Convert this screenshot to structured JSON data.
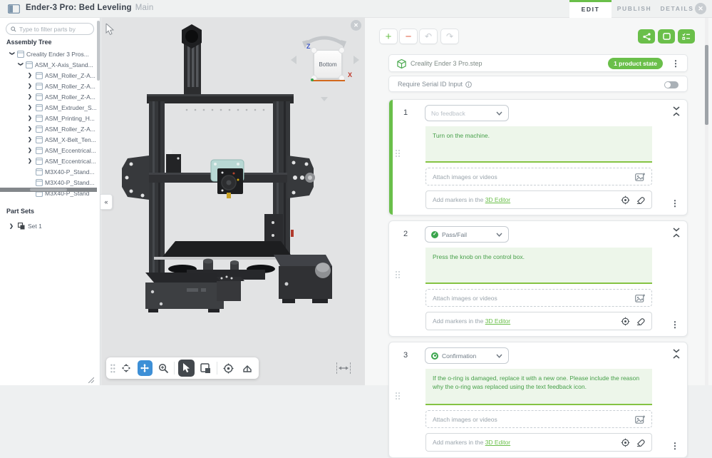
{
  "header": {
    "title": "Ender-3 Pro: Bed Leveling",
    "variant": "Main",
    "tabs": [
      {
        "label": "EDIT",
        "active": true
      },
      {
        "label": "PUBLISH",
        "active": false
      },
      {
        "label": "DETAILS",
        "active": false
      }
    ],
    "icons": [
      "app-layout-icon",
      "window-close-icon"
    ]
  },
  "sidebar": {
    "search_placeholder": "Type to filter parts by",
    "tree_label": "Assembly Tree",
    "tree": [
      {
        "label": "Creality Ender 3 Pros...",
        "depth": 0,
        "expanded": true,
        "expandable": true,
        "type": "assembly"
      },
      {
        "label": "ASM_X-Axis_Stand...",
        "depth": 1,
        "expanded": true,
        "expandable": true,
        "type": "assembly"
      },
      {
        "label": "ASM_Roller_Z-A...",
        "depth": 2,
        "expanded": false,
        "expandable": true,
        "type": "assembly"
      },
      {
        "label": "ASM_Roller_Z-A...",
        "depth": 2,
        "expanded": false,
        "expandable": true,
        "type": "assembly"
      },
      {
        "label": "ASM_Roller_Z-A...",
        "depth": 2,
        "expanded": false,
        "expandable": true,
        "type": "assembly"
      },
      {
        "label": "ASM_Extruder_S...",
        "depth": 2,
        "expanded": false,
        "expandable": true,
        "type": "assembly"
      },
      {
        "label": "ASM_Printing_H...",
        "depth": 2,
        "expanded": false,
        "expandable": true,
        "type": "assembly"
      },
      {
        "label": "ASM_Roller_Z-A...",
        "depth": 2,
        "expanded": false,
        "expandable": true,
        "type": "assembly"
      },
      {
        "label": "ASM_X-Belt_Ten...",
        "depth": 2,
        "expanded": false,
        "expandable": true,
        "type": "assembly"
      },
      {
        "label": "ASM_Eccentrical...",
        "depth": 2,
        "expanded": false,
        "expandable": true,
        "type": "assembly"
      },
      {
        "label": "ASM_Eccentrical...",
        "depth": 2,
        "expanded": false,
        "expandable": true,
        "type": "assembly"
      },
      {
        "label": "M3X40-P_Stand...",
        "depth": 2,
        "expanded": false,
        "expandable": false,
        "type": "part"
      },
      {
        "label": "M3X40-P_Stand...",
        "depth": 2,
        "expanded": false,
        "expandable": false,
        "type": "part"
      },
      {
        "label": "M3X40-P_Stand",
        "depth": 2,
        "expanded": false,
        "expandable": false,
        "type": "part"
      }
    ],
    "part_sets_label": "Part Sets",
    "part_sets": [
      {
        "label": "Set 1"
      }
    ]
  },
  "viewport": {
    "view_cube_label": "Bottom",
    "axis_z": "Z",
    "axis_x": "X",
    "toolbar_icons": [
      "drag-handle-icon",
      "orbit-icon",
      "pan-icon",
      "zoom-icon",
      "select-cursor-icon",
      "box-select-icon",
      "focus-target-icon",
      "section-icon"
    ],
    "active_tools": [
      "pan-icon",
      "select-cursor-icon"
    ],
    "other_icons": [
      "viewport-close-icon",
      "fit-width-icon",
      "mouse-cursor"
    ]
  },
  "editor": {
    "toolbar": {
      "left_icons": [
        "add-step-icon",
        "remove-step-icon",
        "undo-icon",
        "redo-icon"
      ],
      "right_icons": [
        "share-icon",
        "display-icon",
        "checklist-icon",
        "overflow-menu-icon"
      ]
    },
    "product": {
      "name": "Creality Ender 3 Pro.step",
      "badge": "1 product state"
    },
    "serial": {
      "label": "Require Serial ID Input",
      "toggle_on": false
    },
    "attach_label": "Attach images or videos",
    "markers_prefix": "Add markers in the ",
    "markers_link": "3D Editor",
    "steps": [
      {
        "number": "1",
        "feedback": "No feedback",
        "feedback_icon": "none",
        "placeholder": true,
        "selected": true,
        "text": "Turn on the machine."
      },
      {
        "number": "2",
        "feedback": "Pass/Fail",
        "feedback_icon": "check",
        "placeholder": false,
        "selected": false,
        "text": "Press the knob on the control box."
      },
      {
        "number": "3",
        "feedback": "Confirmation",
        "feedback_icon": "ring",
        "placeholder": false,
        "selected": false,
        "text": "If the o-ring is damaged, replace it with a new one. Please include the reason why the o-ring was replaced using the text feedback icon."
      }
    ]
  },
  "colors": {
    "accent_green": "#6abf4a",
    "danger_orange": "#e0634a",
    "step_text_green": "#47a04a",
    "step_bg_green": "#edf6ea",
    "active_blue": "#3d8fd6",
    "selection_teal": "#b8d8d4",
    "axis_z_blue": "#3b55c8",
    "axis_x_red": "#c0392b"
  }
}
